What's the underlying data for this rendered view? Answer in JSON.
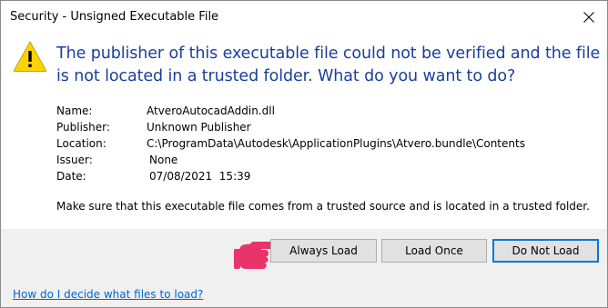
{
  "window": {
    "title": "Security - Unsigned Executable File"
  },
  "headline": "The publisher of this executable file could not be verified and the file is not located in a trusted folder. What do you want to do?",
  "properties": [
    {
      "label": "Name:",
      "value": "AtveroAutocadAddin.dll"
    },
    {
      "label": "Publisher:",
      "value": "Unknown Publisher"
    },
    {
      "label": "Location:",
      "value": "C:\\ProgramData\\Autodesk\\ApplicationPlugins\\Atvero.bundle\\Contents"
    },
    {
      "label": "Issuer:",
      "value": "None"
    },
    {
      "label": "Date:",
      "value": "07/08/2021  15:39"
    }
  ],
  "note": "Make sure that this executable file comes from a trusted source and is located in a trusted folder.",
  "buttons": {
    "always_load": "Always Load",
    "load_once": "Load Once",
    "do_not_load": "Do Not Load"
  },
  "help_link": "How do I decide what files to load?",
  "icons": {
    "warning": "warning-icon",
    "close": "close-icon",
    "pointer": "pointing-hand-icon"
  },
  "colors": {
    "headline": "#1a3f9c",
    "link": "#0066cc",
    "warning_fill": "#ffd200",
    "pointer": "#e8336b",
    "default_button_border": "#0078d7",
    "footer_bg": "#f0f0f0"
  }
}
